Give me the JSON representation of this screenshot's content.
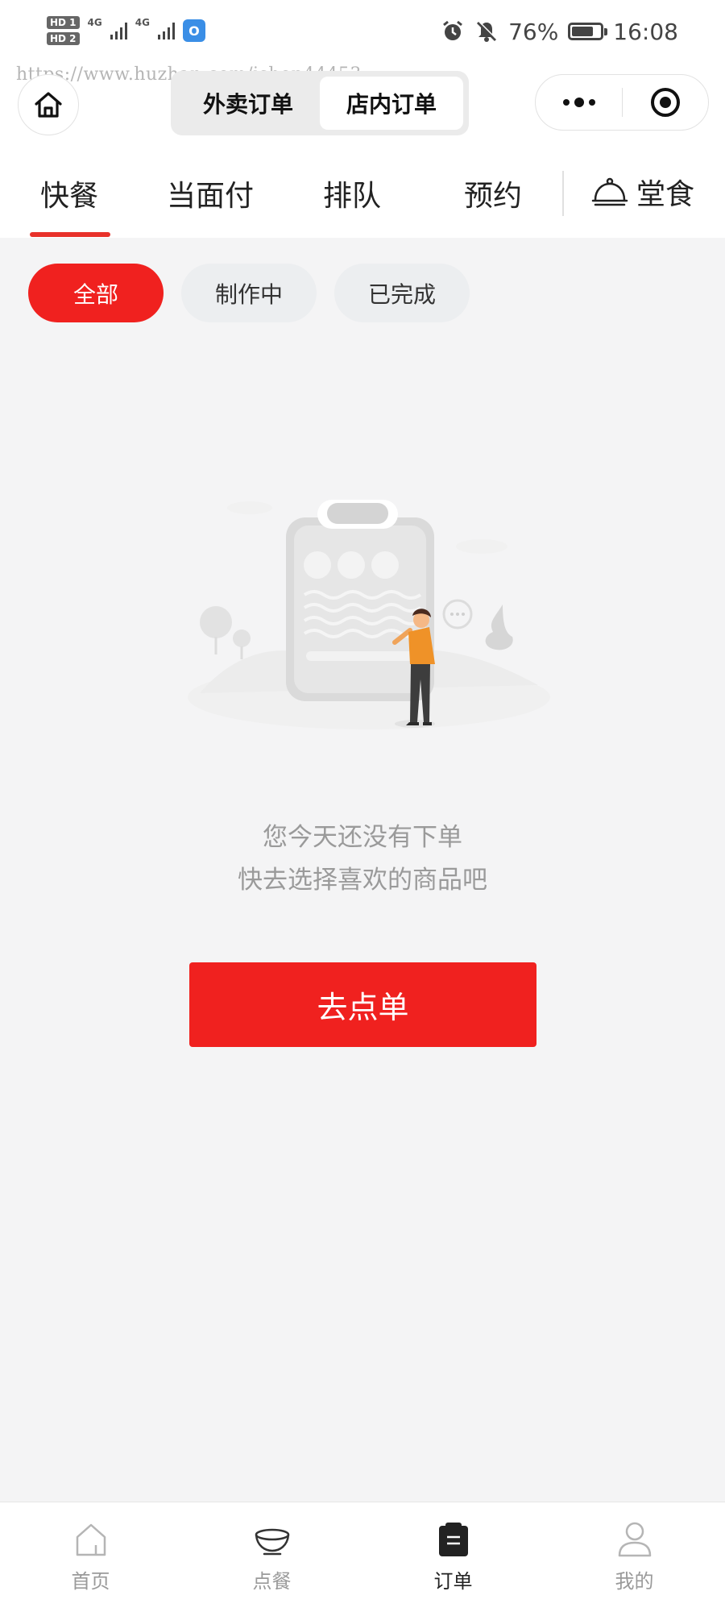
{
  "status_bar": {
    "sim1": "HD 1",
    "sim2": "HD 2",
    "net1": "4G",
    "net2": "4G",
    "app_badge": "O",
    "battery_text": "76%",
    "battery_level": 0.76,
    "time": "16:08",
    "icons": [
      "alarm-icon",
      "mute-icon",
      "battery-icon"
    ]
  },
  "watermark": "https://www.huzhan.com/ishop44453",
  "nav": {
    "segments": [
      "外卖订单",
      "店内订单"
    ],
    "active_segment": 1
  },
  "tabs": {
    "items": [
      "快餐",
      "当面付",
      "排队",
      "预约"
    ],
    "active": 0,
    "dine_label": "堂食"
  },
  "filters": {
    "items": [
      "全部",
      "制作中",
      "已完成"
    ],
    "active": 0
  },
  "empty_state": {
    "line1": "您今天还没有下单",
    "line2": "快去选择喜欢的商品吧",
    "button": "去点单"
  },
  "bottom_nav": {
    "items": [
      "首页",
      "点餐",
      "订单",
      "我的"
    ],
    "active": 2
  },
  "colors": {
    "accent": "#f0211f",
    "background": "#f4f4f5"
  }
}
